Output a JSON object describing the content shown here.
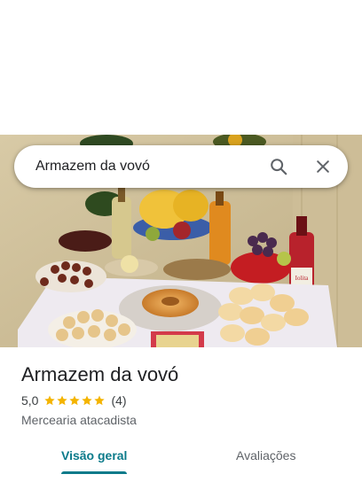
{
  "search": {
    "query": "Armazem da vovó",
    "search_icon": "search-icon",
    "close_icon": "close-icon"
  },
  "photo": {
    "label_text": "Iolita"
  },
  "place": {
    "title": "Armazem da vovó",
    "rating": "5,0",
    "stars": 5,
    "review_count": "(4)",
    "category": "Mercearia atacadista"
  },
  "tabs": [
    {
      "label": "Visão geral",
      "active": true
    },
    {
      "label": "Avaliações",
      "active": false
    }
  ],
  "colors": {
    "accent": "#0b7a8a",
    "star": "#f4b400"
  }
}
